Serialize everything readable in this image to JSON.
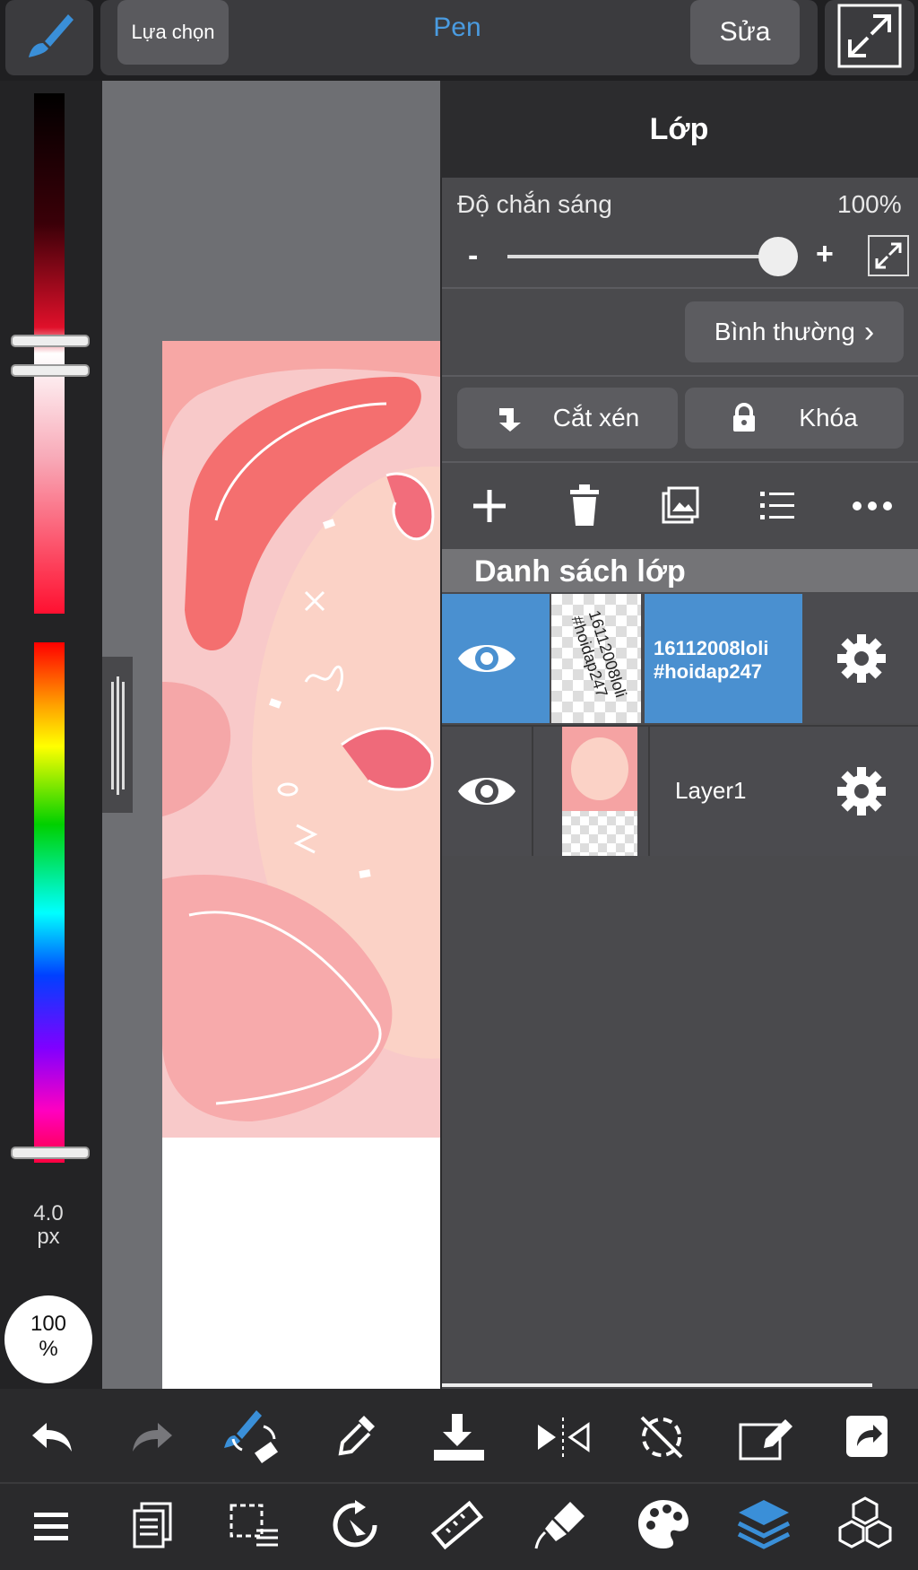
{
  "top": {
    "selection_label": "Lựa chọn",
    "mode_title": "Pen",
    "edit_label": "Sửa"
  },
  "left_panel": {
    "brush_size": "4.0",
    "brush_unit": "px",
    "opacity_value": "100",
    "opacity_unit": "%"
  },
  "layer_panel": {
    "title": "Lớp",
    "opacity_label": "Độ chắn sáng",
    "opacity_value": "100%",
    "opacity_fraction": 1.0,
    "minus_label": "-",
    "plus_label": "+",
    "blend_mode": "Bình thường",
    "clip_label": "Cắt xén",
    "lock_label": "Khóa",
    "list_header": "Danh sách lớp",
    "layers": [
      {
        "name_line1": "16112008loli",
        "name_line2": "#hoidap247",
        "selected": true,
        "visible": true
      },
      {
        "name_line1": "Layer1",
        "name_line2": "",
        "selected": false,
        "visible": true
      }
    ],
    "thumb_text_line1": "16112008loli",
    "thumb_text_line2": "#hoidap247"
  },
  "icons": {
    "top": [
      "brush-icon",
      "expand-icon"
    ],
    "layer_tools": [
      "add-layer-icon",
      "delete-layer-icon",
      "image-layer-icon",
      "layer-list-icon",
      "more-icon"
    ],
    "bottom_row1": [
      "undo-icon",
      "redo-icon",
      "brush-eraser-swap-icon",
      "eyedropper-icon",
      "import-icon",
      "flip-icon",
      "rotate-lock-icon",
      "edit-canvas-icon",
      "share-icon"
    ],
    "bottom_row2": [
      "menu-icon",
      "pages-icon",
      "selection-icon",
      "transform-icon",
      "ruler-icon",
      "fill-icon",
      "palette-icon",
      "layers-icon",
      "materials-icon"
    ]
  },
  "colors": {
    "accent": "#4a9be0",
    "selected_layer": "#4a90d0"
  }
}
